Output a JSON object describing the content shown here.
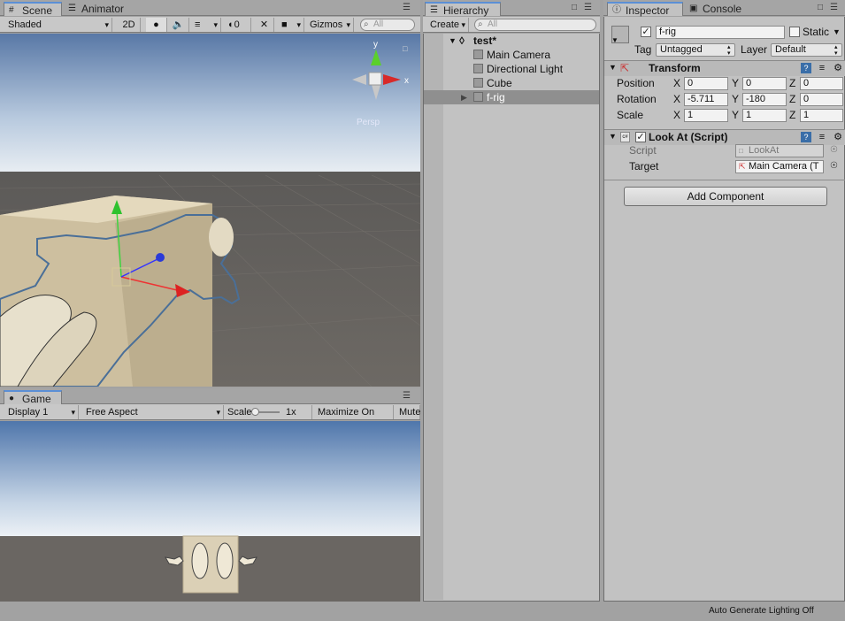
{
  "scene": {
    "tabs": [
      {
        "label": "Scene",
        "icon": "#"
      },
      {
        "label": "Animator",
        "icon": "☰"
      }
    ],
    "toolbar": {
      "shading": "Shaded",
      "mode2d": "2D",
      "hidden_count": "0",
      "gizmos": "Gizmos",
      "search_placeholder": "All"
    },
    "gizmo": {
      "y": "y",
      "x": "x",
      "projection": "Persp"
    }
  },
  "game": {
    "tab": "Game",
    "toolbar": {
      "display": "Display 1",
      "aspect": "Free Aspect",
      "scale_label": "Scale",
      "scale_value": "1x",
      "maximize": "Maximize On Play",
      "mute": "Mute"
    }
  },
  "hierarchy": {
    "tab": "Hierarchy",
    "create": "Create",
    "search_placeholder": "All",
    "scene_name": "test*",
    "items": [
      "Main Camera",
      "Directional Light",
      "Cube",
      "f-rig"
    ]
  },
  "inspector": {
    "tabs": [
      "Inspector",
      "Console"
    ],
    "object_name": "f-rig",
    "static_label": "Static",
    "tag_label": "Tag",
    "tag_value": "Untagged",
    "layer_label": "Layer",
    "layer_value": "Default",
    "transform": {
      "title": "Transform",
      "position_label": "Position",
      "rotation_label": "Rotation",
      "scale_label": "Scale",
      "position": {
        "x": "0",
        "y": "0",
        "z": "0"
      },
      "rotation": {
        "x": "-5.711",
        "y": "-180",
        "z": "0"
      },
      "scale": {
        "x": "1",
        "y": "1",
        "z": "1"
      }
    },
    "lookat": {
      "title": "Look At (Script)",
      "script_label": "Script",
      "script_value": "LookAt",
      "target_label": "Target",
      "target_value": "Main Camera (T"
    },
    "add_component": "Add Component"
  },
  "status": {
    "lighting": "Auto Generate Lighting Off"
  }
}
